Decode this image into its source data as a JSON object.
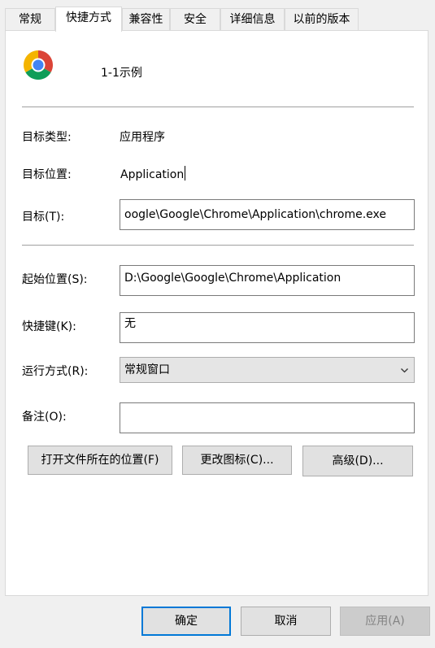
{
  "tabs": [
    {
      "label": "常规"
    },
    {
      "label": "快捷方式"
    },
    {
      "label": "兼容性"
    },
    {
      "label": "安全"
    },
    {
      "label": "详细信息"
    },
    {
      "label": "以前的版本"
    }
  ],
  "shortcut": {
    "icon": "chrome-icon",
    "name": "1-1示例"
  },
  "fields": {
    "target_type_label": "目标类型:",
    "target_type_value": "应用程序",
    "target_location_label": "目标位置:",
    "target_location_value": "Application",
    "target_label": "目标(T):",
    "target_value": "oogle\\Google\\Chrome\\Application\\chrome.exe",
    "start_in_label": "起始位置(S):",
    "start_in_value": "D:\\Google\\Google\\Chrome\\Application",
    "hotkey_label": "快捷键(K):",
    "hotkey_value": "无",
    "run_label": "运行方式(R):",
    "run_value": "常规窗口",
    "comment_label": "备注(O):",
    "comment_value": ""
  },
  "buttons": {
    "open_location": "打开文件所在的位置(F)",
    "change_icon": "更改图标(C)...",
    "advanced": "高级(D)..."
  },
  "footer": {
    "ok": "确定",
    "cancel": "取消",
    "apply": "应用(A)"
  },
  "colors": {
    "focus_border": "#0078d7",
    "panel_bg": "#ffffff",
    "dialog_bg": "#f0f0f0"
  }
}
